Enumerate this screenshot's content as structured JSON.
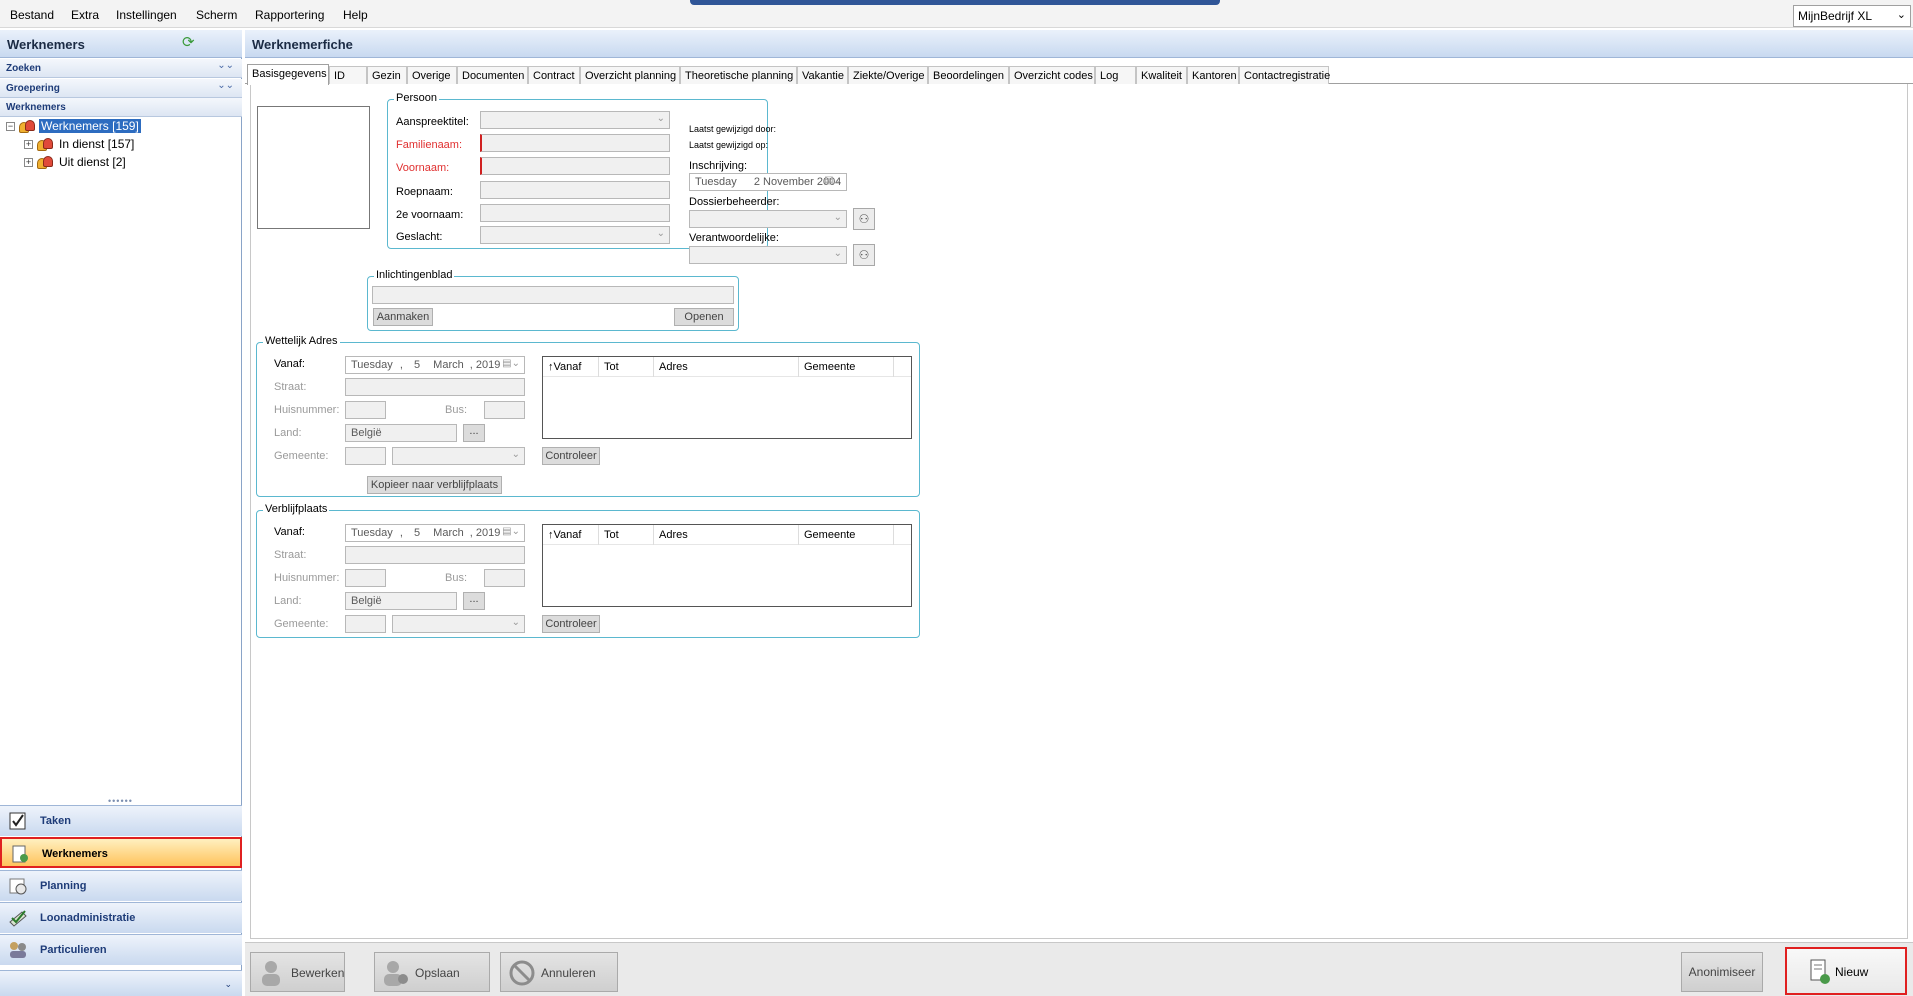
{
  "menu": {
    "items": [
      "Bestand",
      "Extra",
      "Instellingen",
      "Scherm",
      "Rapportering",
      "Help"
    ],
    "company": "MijnBedrijf XL"
  },
  "left": {
    "title": "Werknemers",
    "sections": [
      "Zoeken",
      "Groepering",
      "Werknemers"
    ],
    "tree": [
      {
        "label": "Werknemers [159]"
      },
      {
        "label": "In dienst [157]"
      },
      {
        "label": "Uit dienst [2]"
      }
    ],
    "nav": [
      "Taken",
      "Werknemers",
      "Planning",
      "Loonadministratie",
      "Particulieren"
    ]
  },
  "right": {
    "title": "Werknemerfiche",
    "tabs": [
      "Basisgegevens",
      "ID",
      "Gezin",
      "Overige",
      "Documenten",
      "Contract",
      "Overzicht planning",
      "Theoretische planning",
      "Vakantie",
      "Ziekte/Overige",
      "Beoordelingen",
      "Overzicht codes",
      "Log",
      "Kwaliteit",
      "Kantoren",
      "Contactregistratie"
    ]
  },
  "persoon": {
    "title": "Persoon",
    "aanspreektitel": "Aanspreektitel:",
    "familienaam": "Familienaam:",
    "voornaam": "Voornaam:",
    "roepnaam": "Roepnaam:",
    "tweede_voornaam": "2e voornaam:",
    "geslacht": "Geslacht:"
  },
  "meta": {
    "laatst_door": "Laatst gewijzigd door:",
    "laatst_op": "Laatst gewijzigd op:",
    "inschrijving_label": "Inschrijving:",
    "inschrijving_day": "Tuesday",
    "inschrijving_date": "2 November  2004",
    "dossier_label": "Dossierbeheerder:",
    "verantw_label": "Verantwoordelijke:"
  },
  "inlichtingen": {
    "title": "Inlichtingenblad",
    "aanmaken": "Aanmaken",
    "openen": "Openen"
  },
  "address_common": {
    "vanaf": "Vanaf:",
    "straat": "Straat:",
    "huisnummer": "Huisnummer:",
    "bus": "Bus:",
    "land": "Land:",
    "gemeente": "Gemeente:",
    "land_value": "België",
    "dots": "...",
    "date_day": "Tuesday",
    "date_sep1": ",",
    "date_d": "5",
    "date_month": "March",
    "date_year": ", 2019",
    "controleer": "Controleer",
    "columns": [
      "↑Vanaf",
      "Tot",
      "Adres",
      "Gemeente"
    ]
  },
  "wettelijk": {
    "title": "Wettelijk Adres",
    "kopieer": "Kopieer naar verblijfplaats"
  },
  "verblijf": {
    "title": "Verblijfplaats"
  },
  "buttons": {
    "bewerken": "Bewerken",
    "opslaan": "Opslaan",
    "annuleren": "Annuleren",
    "anonimiseer": "Anonimiseer",
    "nieuw": "Nieuw"
  }
}
